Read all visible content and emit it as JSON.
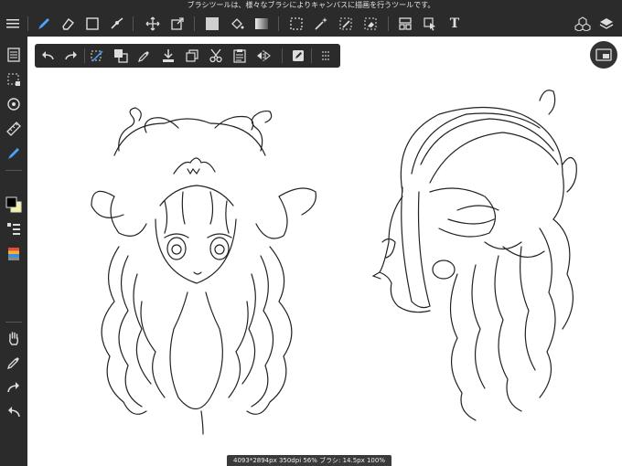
{
  "hint_text": "ブラシツールは、様々なブラシによりキャンバスに描画を行うツールです。",
  "status_text": "4093*2894px 350dpi 56% ブラシ: 14.5px 100%",
  "top_toolbar": {
    "menu_icon": "hamburger-menu-icon",
    "tools": [
      "brush-tool-icon",
      "eraser-tool-icon",
      "select-rect-icon",
      "smudge-tool-icon",
      "move-tool-icon",
      "transform-tool-icon",
      "fill-color-swatch-icon",
      "bucket-tool-icon",
      "gradient-tool-icon",
      "marquee-select-icon",
      "magic-wand-icon",
      "select-pen-icon",
      "select-eraser-icon",
      "frame-divide-icon",
      "select-arrow-icon",
      "text-tool-icon",
      "3d-material-icon",
      "layers-icon"
    ],
    "text_tool_label": "T"
  },
  "edit_toolbar": {
    "items": [
      "undo-icon",
      "redo-icon",
      "deselect-icon",
      "copy-paste-icon",
      "eyedropper-icon",
      "save-download-icon",
      "duplicate-icon",
      "cut-icon",
      "paste-icon",
      "flip-horizontal-icon",
      "edit-icon",
      "grip-icon"
    ]
  },
  "left_sidebar": {
    "items": [
      "page-list-icon",
      "selection-icon",
      "rotate-icon",
      "ruler-icon",
      "brush-active-icon",
      "color-swatch-icon",
      "layer-list-icon",
      "palette-icon",
      "hand-icon",
      "eyedropper-icon",
      "redo-icon",
      "undo-icon"
    ]
  },
  "colors": {
    "chrome": "#2b2b2b",
    "accent": "#4aa3ff",
    "canvas": "#ffffff",
    "primary_swatch": "#000000",
    "secondary_swatch": "#f3f0a0"
  }
}
